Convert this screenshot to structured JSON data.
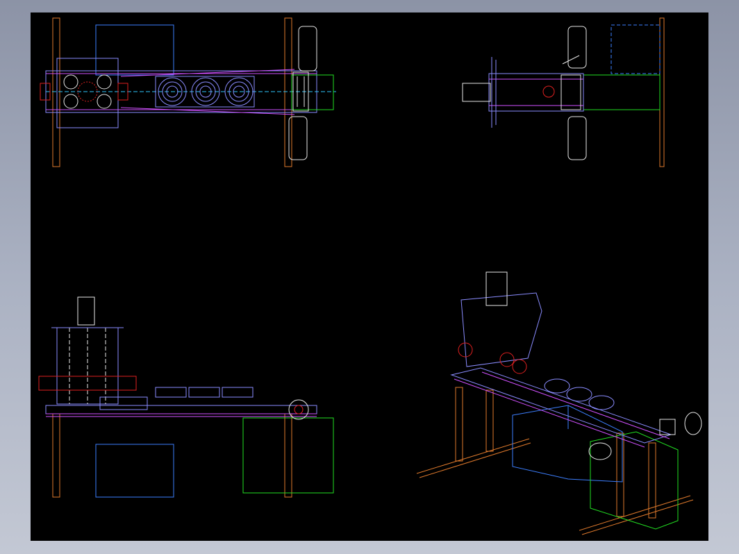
{
  "viewport": {
    "background": "#000000",
    "frame": "#aab1c2"
  },
  "layer_colors": {
    "frame_orange": "#e07a2c",
    "outline_blue": "#3d7fff",
    "part_violet": "#8a8cff",
    "belt_magenta": "#d050ff",
    "box_green": "#22e022",
    "motor_white": "#e8e8e8",
    "clamp_red": "#e02020",
    "link_cyan": "#30c8ff"
  },
  "views": [
    {
      "name": "top-view"
    },
    {
      "name": "right-side-view"
    },
    {
      "name": "front-view"
    },
    {
      "name": "isometric-view"
    }
  ]
}
